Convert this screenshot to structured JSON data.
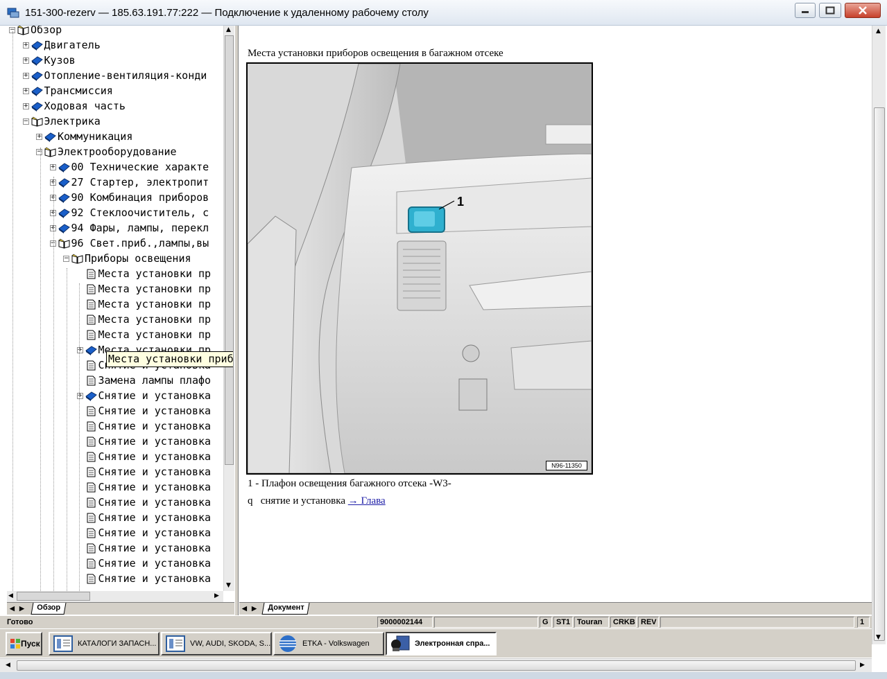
{
  "window": {
    "title": "151-300-rezerv — 185.63.191.77:222 — Подключение к удаленному рабочему столу",
    "min_glyph": "‒",
    "max_glyph": "□",
    "close_glyph": "✕"
  },
  "tree": {
    "nodes": [
      {
        "label": "Обзор",
        "icon": "open-book-icon",
        "expander": "−"
      },
      {
        "label": "Двигатель",
        "icon": "closed-book-icon",
        "expander": "+"
      },
      {
        "label": "Кузов",
        "icon": "closed-book-icon",
        "expander": "+"
      },
      {
        "label": "Отопление-вентиляция-конди",
        "icon": "closed-book-icon",
        "expander": "+"
      },
      {
        "label": "Трансмиссия",
        "icon": "closed-book-icon",
        "expander": "+"
      },
      {
        "label": "Ходовая часть",
        "icon": "closed-book-icon",
        "expander": "+"
      },
      {
        "label": "Электрика",
        "icon": "open-book-icon",
        "expander": "−"
      },
      {
        "label": "Коммуникация",
        "icon": "closed-book-icon",
        "expander": "+"
      },
      {
        "label": "Электрооборудование",
        "icon": "open-book-icon",
        "expander": "−"
      },
      {
        "label": "00 Технические характе",
        "icon": "closed-book-icon",
        "expander": "+"
      },
      {
        "label": "27 Стартер, электропит",
        "icon": "closed-book-icon",
        "expander": "+"
      },
      {
        "label": "90 Комбинация приборов",
        "icon": "closed-book-icon",
        "expander": "+"
      },
      {
        "label": "92 Стеклоочиститель, с",
        "icon": "closed-book-icon",
        "expander": "+"
      },
      {
        "label": "94 Фары, лампы, перекл",
        "icon": "closed-book-icon",
        "expander": "+"
      },
      {
        "label": "96 Свет.приб.,лампы,вы",
        "icon": "open-book-icon",
        "expander": "−"
      },
      {
        "label": "Приборы освещения",
        "icon": "open-book-icon",
        "expander": "−"
      },
      {
        "label": "Места установки пр",
        "icon": "page-icon",
        "expander": ""
      },
      {
        "label": "Места установки пр",
        "icon": "page-icon",
        "expander": ""
      },
      {
        "label": "Места установки пр",
        "icon": "page-icon",
        "expander": ""
      },
      {
        "label": "Места установки пр",
        "icon": "page-icon",
        "expander": ""
      },
      {
        "label": "Места установки пр",
        "icon": "page-icon",
        "expander": ""
      },
      {
        "label": "Места установки пр",
        "icon": "closed-book-icon",
        "expander": "+"
      },
      {
        "label": "Снятие и установка",
        "icon": "page-icon",
        "expander": ""
      },
      {
        "label": "Замена лампы плафо",
        "icon": "page-icon",
        "expander": ""
      },
      {
        "label": "Снятие и установка",
        "icon": "closed-book-icon",
        "expander": "+"
      },
      {
        "label": "Снятие и установка",
        "icon": "page-icon",
        "expander": ""
      },
      {
        "label": "Снятие и установка",
        "icon": "page-icon",
        "expander": ""
      },
      {
        "label": "Снятие и установка",
        "icon": "page-icon",
        "expander": ""
      },
      {
        "label": "Снятие и установка",
        "icon": "page-icon",
        "expander": ""
      },
      {
        "label": "Снятие и установка",
        "icon": "page-icon",
        "expander": ""
      },
      {
        "label": "Снятие и установка",
        "icon": "page-icon",
        "expander": ""
      },
      {
        "label": "Снятие и установка",
        "icon": "page-icon",
        "expander": ""
      },
      {
        "label": "Снятие и установка",
        "icon": "page-icon",
        "expander": ""
      },
      {
        "label": "Снятие и установка",
        "icon": "page-icon",
        "expander": ""
      },
      {
        "label": "Снятие и установка",
        "icon": "page-icon",
        "expander": ""
      },
      {
        "label": "Снятие и установка",
        "icon": "page-icon",
        "expander": ""
      },
      {
        "label": "Снятие и установка",
        "icon": "page-icon",
        "expander": ""
      }
    ],
    "tooltip": "Места установки приборов освещения в багажном отсеке",
    "tab_label": "Обзор"
  },
  "document": {
    "heading": "Места установки приборов освещения в багажном отсеке",
    "callout_number": "1",
    "figure_code": "N96-11350",
    "caption": "1 -  Плафон освещения багажного отсека -W3-",
    "bullet": "q",
    "subline_text": "снятие и установка ",
    "link_label": "→ Глава",
    "tab_label": "Документ"
  },
  "status": {
    "ready": "Готово",
    "code": "9000002144",
    "g": "G",
    "st": "ST1",
    "model": "Touran",
    "engine": "CRKB",
    "rev": "REV",
    "page": "1"
  },
  "taskbar": {
    "start": "Пуск",
    "tasks": [
      {
        "label": "КАТАЛОГИ ЗАПАСН..."
      },
      {
        "label": "VW, AUDI, SKODA, S..."
      },
      {
        "label": "ETKA - Volkswagen"
      },
      {
        "label": "Электронная спра..."
      }
    ]
  },
  "colors": {
    "accent_blue": "#1a5fc9",
    "lamp_cyan": "#2fb0cf",
    "tooltip_bg": "#ffffe1",
    "panel_gray": "#d4d0c8"
  }
}
